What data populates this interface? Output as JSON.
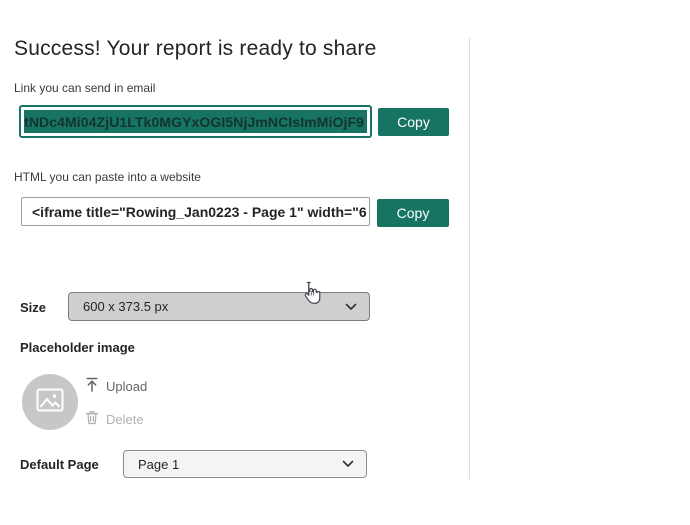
{
  "page": {
    "title": "Success! Your report is ready to share"
  },
  "email_section": {
    "label": "Link you can send in email",
    "link_value": "tNDc4Mi04ZjU1LTk0MGYxOGI5NjJmNCIsImMiOjF9",
    "copy_label": "Copy"
  },
  "html_section": {
    "label": "HTML you can paste into a website",
    "embed_value": "<iframe title=\"Rowing_Jan0223 - Page 1\" width=\"6",
    "copy_label": "Copy"
  },
  "size_section": {
    "label": "Size",
    "selected_option": "600 x 373.5 px"
  },
  "placeholder_section": {
    "label": "Placeholder image",
    "upload_label": "Upload",
    "delete_label": "Delete"
  },
  "default_page_section": {
    "label": "Default Page",
    "selected_option": "Page 1"
  },
  "colors": {
    "accent_teal": "#177362",
    "selection_background": "#177362",
    "selection_text": "#11352e",
    "size_dropdown_background": "#cfcfcf",
    "page_dropdown_background": "#f5f4f3",
    "disabled_text": "#b1b0af",
    "divider": "#dcdcdc",
    "avatar_circle": "#c7c7c7"
  },
  "icons": {
    "upload": "upload-arrow-icon",
    "delete": "trash-icon",
    "placeholder": "image-icon",
    "dropdowns": "chevron-down-icon",
    "pointer": "hand-cursor"
  }
}
